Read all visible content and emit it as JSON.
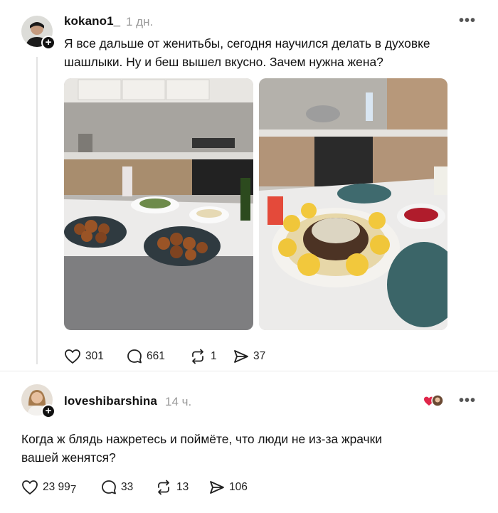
{
  "post": {
    "username": "kokano1_",
    "time": "1 дн.",
    "text_line1": "Я все дальше от женитьбы, сегодня научился делать в духовке",
    "text_line2": "шашлыки. Ну и беш вышел вкусно. Зачем нужна жена?",
    "likes": "301",
    "comments": "661",
    "reposts": "1",
    "shares": "37"
  },
  "reply": {
    "username": "loveshibarshina",
    "time": "14 ч.",
    "text_line1": "Когда ж блядь нажретесь и поймёте, что люди не из-за жрачки",
    "text_line2": "вашей женятся?",
    "likes": "23 99",
    "likes_suffix": "7",
    "comments": "33",
    "reposts": "13",
    "shares": "106"
  },
  "icons": {
    "more": "more-icon",
    "like": "heart-icon",
    "comment": "comment-icon",
    "repost": "repost-icon",
    "share": "share-icon"
  },
  "colors": {
    "accent_heart": "#e0264a",
    "text_muted": "#9a9a9a"
  }
}
